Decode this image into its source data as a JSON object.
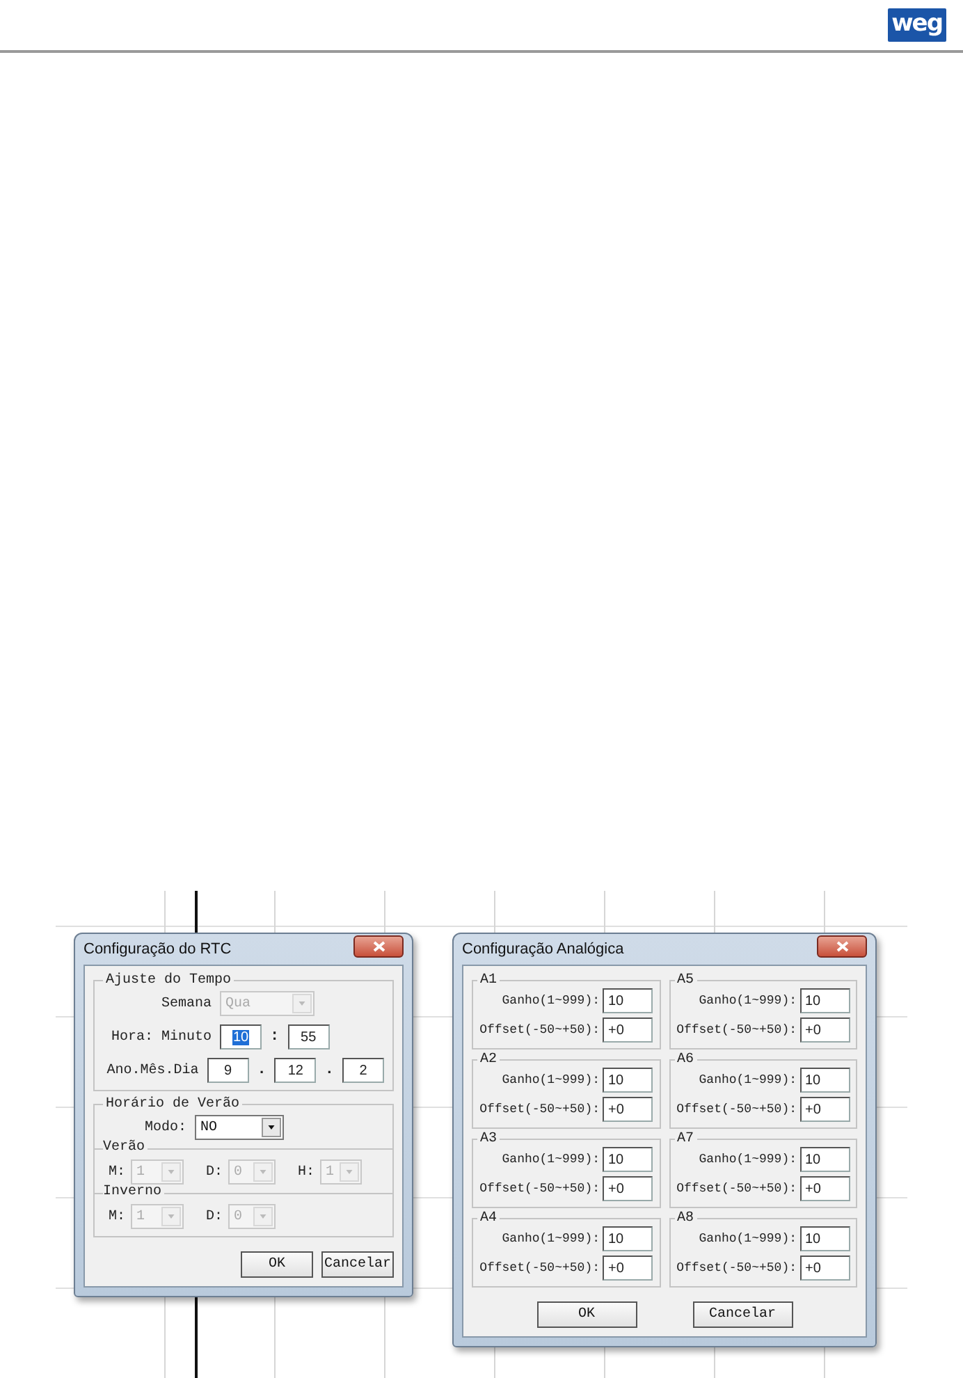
{
  "header": {
    "logo": "weg"
  },
  "rtc_dialog": {
    "title": "Configuração do RTC",
    "time_group": {
      "legend": "Ajuste do Tempo",
      "weekday": {
        "label": "Semana",
        "value": "Qua",
        "disabled": true
      },
      "time": {
        "label": "Hora: Minuto",
        "separator": ":",
        "fields": [
          {
            "value": "10",
            "selected": true
          },
          {
            "value": "55",
            "selected": false
          }
        ]
      },
      "date": {
        "label": "Ano.Mês.Dia",
        "separator": ".",
        "fields": [
          {
            "value": "9",
            "selected": false
          },
          {
            "value": "12",
            "selected": false
          },
          {
            "value": "2",
            "selected": false
          }
        ]
      }
    },
    "dst_group": {
      "legend": "Horário de Verão",
      "mode": {
        "label": "Modo:",
        "value": "NO",
        "disabled": false
      },
      "subgroups": [
        {
          "legend": "Verão",
          "combos": [
            {
              "label": "M:",
              "value": "1",
              "disabled": true
            },
            {
              "label": "D:",
              "value": "0",
              "disabled": true
            },
            {
              "label": "H:",
              "value": "1",
              "disabled": true
            }
          ]
        },
        {
          "legend": "Inverno",
          "combos": [
            {
              "label": "M:",
              "value": "1",
              "disabled": true
            },
            {
              "label": "D:",
              "value": "0",
              "disabled": true
            }
          ]
        }
      ]
    },
    "buttons": [
      "OK",
      "Cancelar"
    ]
  },
  "analog_dialog": {
    "title": "Configuração Analógica",
    "channels": [
      {
        "name": "A1",
        "gain_label": "Ganho(1~999):",
        "gain": "10",
        "offset_label": "Offset(-50~+50):",
        "offset": "+0"
      },
      {
        "name": "A5",
        "gain_label": "Ganho(1~999):",
        "gain": "10",
        "offset_label": "Offset(-50~+50):",
        "offset": "+0"
      },
      {
        "name": "A2",
        "gain_label": "Ganho(1~999):",
        "gain": "10",
        "offset_label": "Offset(-50~+50):",
        "offset": "+0"
      },
      {
        "name": "A6",
        "gain_label": "Ganho(1~999):",
        "gain": "10",
        "offset_label": "Offset(-50~+50):",
        "offset": "+0"
      },
      {
        "name": "A3",
        "gain_label": "Ganho(1~999):",
        "gain": "10",
        "offset_label": "Offset(-50~+50):",
        "offset": "+0"
      },
      {
        "name": "A7",
        "gain_label": "Ganho(1~999):",
        "gain": "10",
        "offset_label": "Offset(-50~+50):",
        "offset": "+0"
      },
      {
        "name": "A4",
        "gain_label": "Ganho(1~999):",
        "gain": "10",
        "offset_label": "Offset(-50~+50):",
        "offset": "+0"
      },
      {
        "name": "A8",
        "gain_label": "Ganho(1~999):",
        "gain": "10",
        "offset_label": "Offset(-50~+50):",
        "offset": "+0"
      }
    ],
    "buttons": [
      "OK",
      "Cancelar"
    ]
  }
}
